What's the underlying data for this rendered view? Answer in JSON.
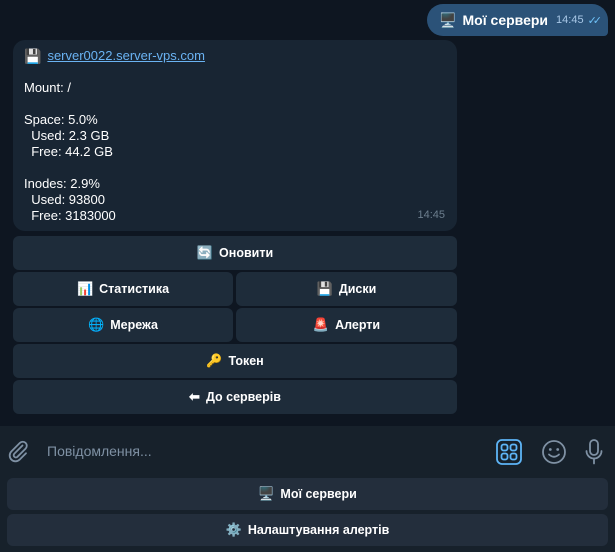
{
  "outgoing": {
    "emoji": "🖥️",
    "text": "Мої сервери",
    "time": "14:45"
  },
  "incoming": {
    "disk_emoji": "💾",
    "link": "server0022.server-vps.com",
    "lines": {
      "mount": "Mount: /",
      "space": "Space: 5.0%",
      "space_used": "  Used: 2.3 GB",
      "space_free": "  Free: 44.2 GB",
      "inodes": "Inodes: 2.9%",
      "inodes_used": "  Used: 93800",
      "inodes_free": "  Free: 3183000"
    },
    "time": "14:45"
  },
  "inline_keyboard": {
    "refresh": {
      "icon": "🔄",
      "label": "Оновити"
    },
    "stats": {
      "icon": "📊",
      "label": "Статистика"
    },
    "disks": {
      "icon": "💾",
      "label": "Диски"
    },
    "network": {
      "icon": "🌐",
      "label": "Мережа"
    },
    "alerts": {
      "icon": "🚨",
      "label": "Алерти"
    },
    "token": {
      "icon": "🔑",
      "label": "Токен"
    },
    "back": {
      "icon": "⬅",
      "label": "До серверів"
    }
  },
  "input": {
    "placeholder": "Повідомлення..."
  },
  "reply_keyboard": {
    "my_servers": {
      "icon": "🖥️",
      "label": "Мої сервери"
    },
    "alert_settings": {
      "icon": "⚙️",
      "label": "Налаштування алертів"
    }
  },
  "colors": {
    "background": "#0e1621",
    "outgoing_bubble": "#2b5278",
    "incoming_bubble": "#182533",
    "link": "#6ab3f3",
    "accent": "#5eb5f7",
    "keyboard_button": "#1e2c3a"
  }
}
